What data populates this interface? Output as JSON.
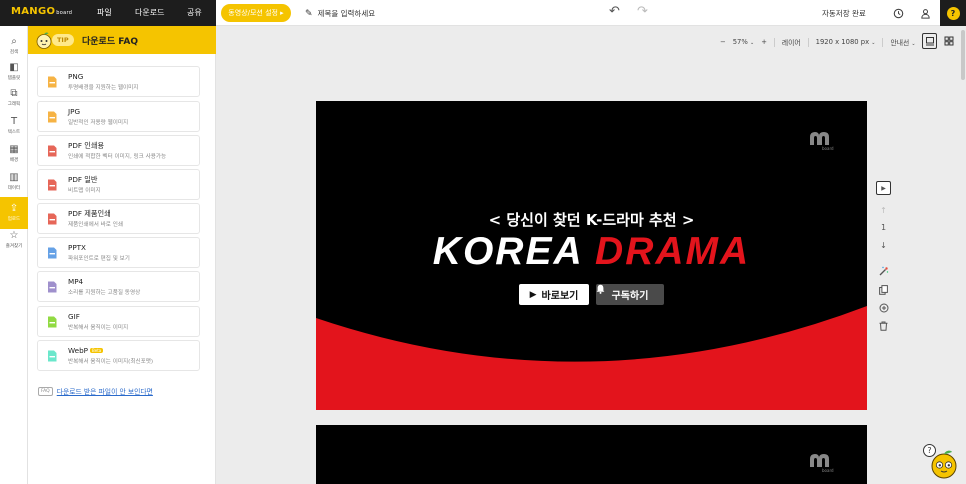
{
  "topbar": {
    "logo": "MANGO",
    "logo_sub": "board",
    "menu": [
      "파일",
      "다운로드",
      "공유"
    ],
    "video_setting": "동영상/모션 설정 ▸",
    "title_placeholder": "제목을 입력하세요",
    "autosave": "자동저장 완료"
  },
  "sidebar": {
    "items": [
      {
        "label": "검색",
        "icon": "search-icon",
        "glyph": "⌕"
      },
      {
        "label": "템플릿",
        "icon": "template-icon",
        "glyph": "◧"
      },
      {
        "label": "그래픽",
        "icon": "graphic-icon",
        "glyph": "⧉"
      },
      {
        "label": "텍스트",
        "icon": "text-icon",
        "glyph": "T"
      },
      {
        "label": "배경",
        "icon": "background-icon",
        "glyph": "▦"
      },
      {
        "label": "데이터",
        "icon": "data-icon",
        "glyph": "▥"
      },
      {
        "label": "업로드",
        "icon": "upload-icon",
        "glyph": "⇪"
      },
      {
        "label": "즐겨찾기",
        "icon": "star-icon",
        "glyph": "☆"
      }
    ],
    "active_index": 6
  },
  "panel": {
    "tip_badge": "TIP",
    "title": "다운로드 FAQ",
    "items": [
      {
        "name": "PNG",
        "desc": "투명배경을 지원하는 웹이미지",
        "icon": "image-file-icon",
        "color": "#f5a623",
        "beta": ""
      },
      {
        "name": "JPG",
        "desc": "일반적인 저용량 웹이미지",
        "icon": "image-file-icon",
        "color": "#f5a623",
        "beta": ""
      },
      {
        "name": "PDF 인쇄용",
        "desc": "인쇄에 적합한 벡터 이미지, 링크 사용가능",
        "icon": "pdf-file-icon",
        "color": "#e24b3b",
        "beta": ""
      },
      {
        "name": "PDF 일반",
        "desc": "비트맵 이미지",
        "icon": "pdf-file-icon",
        "color": "#e24b3b",
        "beta": ""
      },
      {
        "name": "PDF 제품인쇄",
        "desc": "제품인쇄에서 바로 인쇄",
        "icon": "pdf-file-icon",
        "color": "#e24b3b",
        "beta": ""
      },
      {
        "name": "PPTX",
        "desc": "파워포인트로 편집 및 보기",
        "icon": "pptx-file-icon",
        "color": "#4a90e2",
        "beta": ""
      },
      {
        "name": "MP4",
        "desc": "소리를 지원하는 고품질 동영상",
        "icon": "video-file-icon",
        "color": "#8e7cc3",
        "beta": ""
      },
      {
        "name": "GIF",
        "desc": "반복해서 움직이는 이미지",
        "icon": "gif-file-icon",
        "color": "#7ed321",
        "beta": ""
      },
      {
        "name": "WebP",
        "desc": "반복해서 움직이는 이미지(최신포맷)",
        "icon": "webp-file-icon",
        "color": "#50e3c2",
        "beta": "Beta"
      }
    ],
    "faq_badge": "FAQ",
    "faq_link": "다운로드 받은 파일이 안 보인다면"
  },
  "zoom": {
    "minus": "−",
    "level": "57%",
    "plus": "+",
    "layer": "레이어",
    "size": "1920 x 1080 px",
    "guide": "안내선"
  },
  "slide": {
    "subtitle": "< 당신이 찾던 K-드라마 추천 >",
    "title_white": "KOREA",
    "title_red": "DRAMA",
    "btn_watch": "바로보기",
    "btn_subscribe": "구독하기",
    "logo_sub": "board",
    "colors": {
      "bg": "#000000",
      "accent": "#e3141c"
    }
  },
  "page_tools": {
    "page_number": "1"
  },
  "help": {
    "glyph": "?"
  }
}
